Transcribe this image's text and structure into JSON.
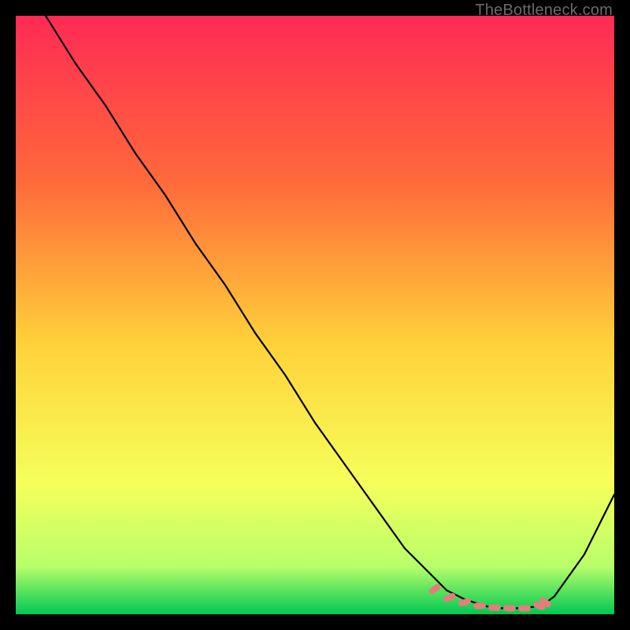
{
  "watermark": "TheBottleneck.com",
  "chart_data": {
    "type": "line",
    "title": "",
    "xlabel": "",
    "ylabel": "",
    "xlim": [
      0,
      100
    ],
    "ylim": [
      0,
      100
    ],
    "grid": false,
    "series": [
      {
        "name": "curve",
        "color": "#000000",
        "x": [
          5,
          10,
          15,
          20,
          25,
          30,
          35,
          40,
          45,
          50,
          55,
          60,
          65,
          70,
          72,
          75,
          78,
          80,
          82,
          85,
          88,
          90,
          95,
          100
        ],
        "y": [
          100,
          92,
          85,
          77,
          70,
          62,
          55,
          47,
          40,
          32,
          25,
          18,
          11,
          6,
          4,
          2.5,
          1.5,
          1,
          1,
          1,
          1.5,
          3,
          10,
          20
        ]
      }
    ],
    "markers": {
      "name": "highlight-dots",
      "color": "#e77c7c",
      "x": [
        70,
        72.5,
        75,
        77.5,
        80,
        82.5,
        85,
        87.5,
        88.5
      ],
      "y": [
        4.2,
        2.8,
        2.0,
        1.4,
        1.1,
        1.0,
        1.0,
        1.4,
        2.0
      ]
    },
    "background_gradient": {
      "top": "#ff2a55",
      "mid_upper": "#ff8a3a",
      "mid": "#ffd23a",
      "mid_lower": "#f6ff5a",
      "lower": "#b8ff6a",
      "bottom": "#00c853"
    }
  }
}
